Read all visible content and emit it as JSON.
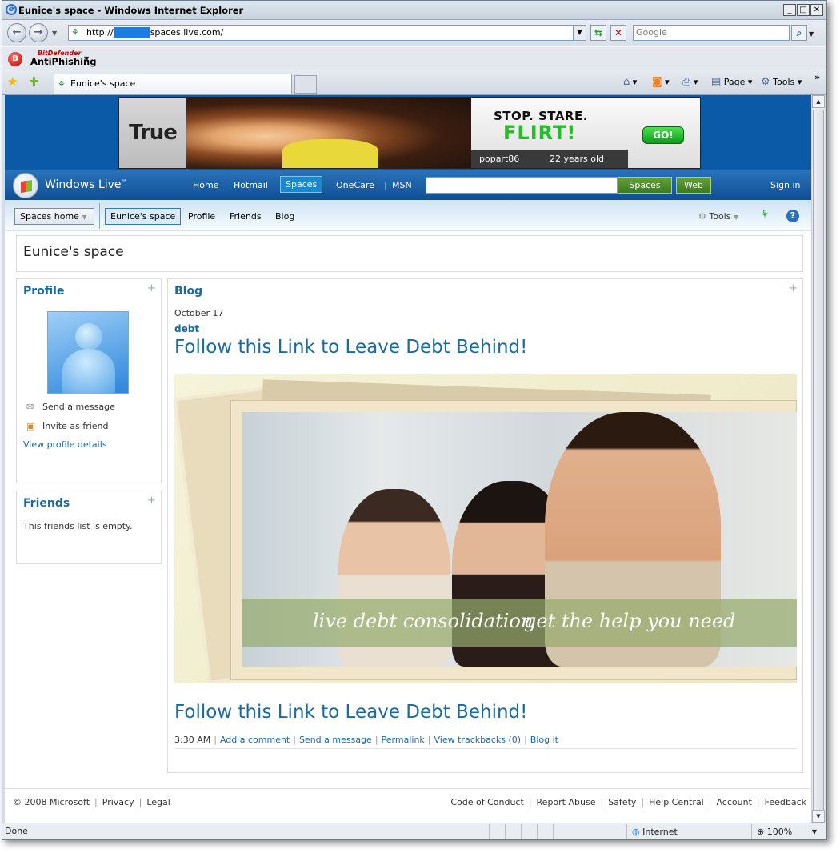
{
  "window": {
    "title": "Eunice's space - Windows Internet Explorer",
    "address_prefix": "http://",
    "address_suffix": "spaces.live.com/",
    "search_placeholder": "Google"
  },
  "toolbar": {
    "antiphishing_brand": "BitDefender",
    "antiphishing_label": "AntiPhishing",
    "tab_label": "Eunice's space",
    "page_label": "Page",
    "tools_label": "Tools"
  },
  "ad": {
    "brand": "True",
    "headline1": "STOP. STARE.",
    "headline2": "FLIRT!",
    "go_label": "GO!",
    "username": "popart86",
    "age": "22 years old"
  },
  "live_header": {
    "logo_text": "Windows Live",
    "trademark": "™",
    "nav": [
      "Home",
      "Hotmail",
      "Spaces",
      "OneCare",
      "MSN"
    ],
    "search_spaces": "Spaces",
    "search_web": "Web",
    "sign_in": "Sign in"
  },
  "subnav": {
    "spaces_home": "Spaces home",
    "current_space": "Eunice's space",
    "items": [
      "Profile",
      "Friends",
      "Blog"
    ],
    "tools": "Tools"
  },
  "space": {
    "title": "Eunice's space"
  },
  "profile": {
    "heading": "Profile",
    "send_message": "Send a message",
    "invite_friend": "Invite as friend",
    "view_details": "View profile details"
  },
  "friends": {
    "heading": "Friends",
    "empty_text": "This friends list is empty."
  },
  "blog": {
    "heading": "Blog",
    "date": "October 17",
    "category": "debt",
    "post_title": "Follow this Link to Leave Debt Behind!",
    "image_caption1": "live debt consolidation",
    "image_caption2": "get the help you need",
    "post_title_bottom": "Follow this Link to Leave Debt Behind!",
    "time": "3:30 AM",
    "actions": [
      "Add a comment",
      "Send a message",
      "Permalink",
      "View trackbacks (0)",
      "Blog it"
    ]
  },
  "footer": {
    "copyright": "© 2008 Microsoft",
    "left_links": [
      "Privacy",
      "Legal"
    ],
    "right_links": [
      "Code of Conduct",
      "Report Abuse",
      "Safety",
      "Help Central",
      "Account",
      "Feedback"
    ]
  },
  "status": {
    "text": "Done",
    "zone": "Internet",
    "zoom": "100%"
  }
}
